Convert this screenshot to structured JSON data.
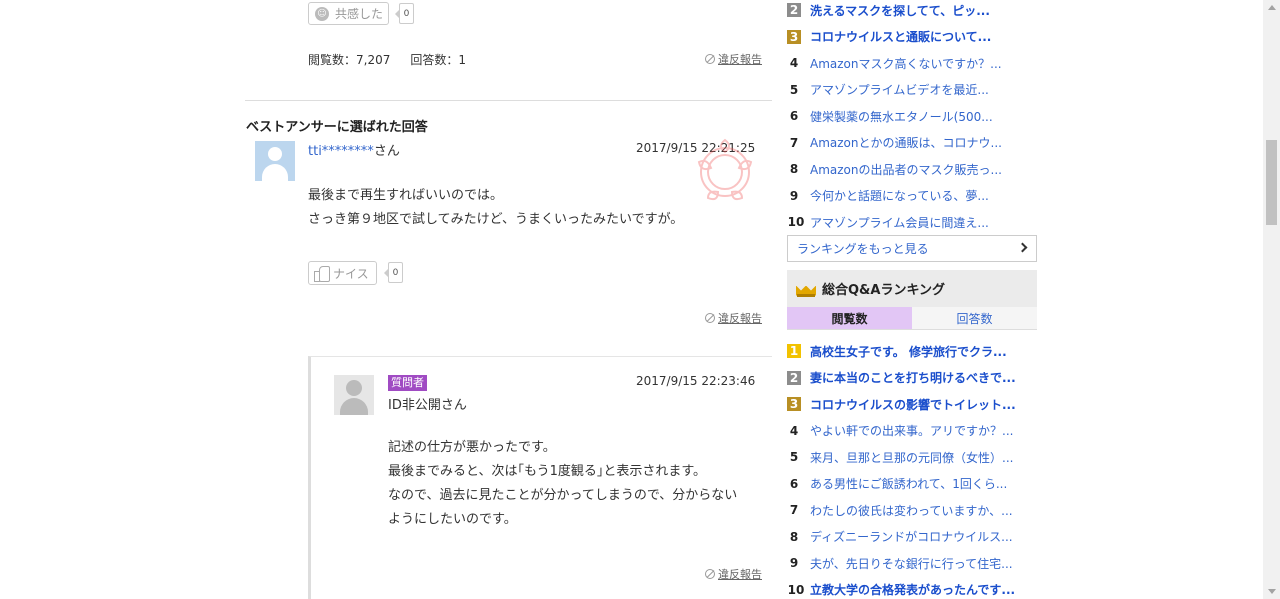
{
  "question": {
    "empathy_label": "共感した",
    "empathy_count": "0",
    "views": "閲覧数：7,207",
    "answers": "回答数：1",
    "report_label": "違反報告"
  },
  "best_answer": {
    "heading": "ベストアンサーに選ばれた回答",
    "username": "tti********",
    "san": "さん",
    "timestamp": "2017/9/15  22:21:25",
    "lines": [
      "最後まで再生すればいいのでは。",
      "さっき第９地区で試してみたけど、うまくいったみたいですが。"
    ],
    "nice_label": "ナイス",
    "nice_count": "0",
    "report_label": "違反報告"
  },
  "reply": {
    "badge": "質問者",
    "username": "ID非公開さん",
    "timestamp": "2017/9/15  22:23:46",
    "lines": [
      "記述の仕方が悪かったです。",
      "最後までみると、次は｢もう1度観る｣と表示されます。",
      "なので、過去に見たことが分かってしまうので、分からない",
      "ようにしたいのです。"
    ],
    "report_label": "違反報告"
  },
  "category_ranking": {
    "items": [
      {
        "rank": "2",
        "title": "洗えるマスクを探してて、ピッ...",
        "medal": "silver"
      },
      {
        "rank": "3",
        "title": "コロナウイルスと通販について...",
        "medal": "bronze"
      },
      {
        "rank": "4",
        "title": "Amazonマスク高くないですか？..."
      },
      {
        "rank": "5",
        "title": "アマゾンプライムビデオを最近..."
      },
      {
        "rank": "6",
        "title": "健栄製薬の無水エタノール(500..."
      },
      {
        "rank": "7",
        "title": "Amazonとかの通販は、コロナウ..."
      },
      {
        "rank": "8",
        "title": "Amazonの出品者のマスク販売っ..."
      },
      {
        "rank": "9",
        "title": "今何かと話題になっている、夢..."
      },
      {
        "rank": "10",
        "title": "アマゾンプライム会員に間違え..."
      }
    ],
    "more_label": "ランキングをもっと見る"
  },
  "overall_ranking": {
    "title": "総合Q&Aランキング",
    "tabs": [
      "閲覧数",
      "回答数"
    ],
    "active_tab": "閲覧数",
    "items": [
      {
        "rank": "1",
        "title": "高校生女子です。 修学旅行でクラ...",
        "medal": "gold"
      },
      {
        "rank": "2",
        "title": "妻に本当のことを打ち明けるべきで...",
        "medal": "silver"
      },
      {
        "rank": "3",
        "title": "コロナウイルスの影響でトイレット...",
        "medal": "bronze"
      },
      {
        "rank": "4",
        "title": "やよい軒での出来事。アリですか？..."
      },
      {
        "rank": "5",
        "title": "来月、旦那と旦那の元同僚（女性）..."
      },
      {
        "rank": "6",
        "title": "ある男性にご飯誘われて、1回くら..."
      },
      {
        "rank": "7",
        "title": "わたしの彼氏は変わっていますか、..."
      },
      {
        "rank": "8",
        "title": "ディズニーランドがコロナウイルス..."
      },
      {
        "rank": "9",
        "title": "夫が、先日りそな銀行に行って住宅..."
      },
      {
        "rank": "10",
        "title": "立教大学の合格発表があったんです..."
      }
    ]
  },
  "colors": {
    "link": "#3366cc",
    "asker_badge": "#a04bc3",
    "active_tab": "#e2c6f5",
    "gold": "#f2c200",
    "silver": "#8c8c8c",
    "bronze": "#b88f24"
  }
}
